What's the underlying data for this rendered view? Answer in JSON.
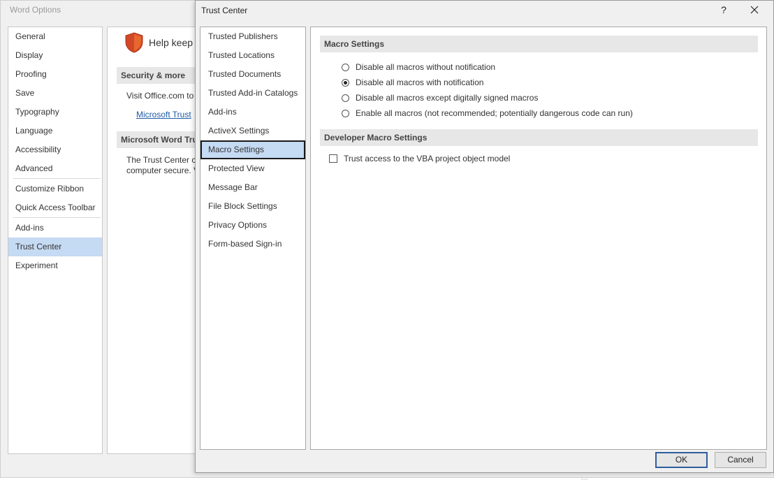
{
  "word_options": {
    "title": "Word Options",
    "nav": [
      "General",
      "Display",
      "Proofing",
      "Save",
      "Typography",
      "Language",
      "Accessibility",
      "Advanced",
      "Customize Ribbon",
      "Quick Access Toolbar",
      "Add-ins",
      "Trust Center",
      "Experiment"
    ],
    "selected_nav": "Trust Center",
    "content": {
      "help_keep": "Help keep y",
      "section1": "Security & more",
      "visit_text": "Visit Office.com to",
      "trust_link": "Microsoft Trust",
      "section2": "Microsoft Word Tru",
      "body_line1": "The Trust Center co",
      "body_line2": "computer secure. V"
    }
  },
  "trust_center": {
    "title": "Trust Center",
    "help_label": "?",
    "nav": [
      "Trusted Publishers",
      "Trusted Locations",
      "Trusted Documents",
      "Trusted Add-in Catalogs",
      "Add-ins",
      "ActiveX Settings",
      "Macro Settings",
      "Protected View",
      "Message Bar",
      "File Block Settings",
      "Privacy Options",
      "Form-based Sign-in"
    ],
    "selected_nav": "Macro Settings",
    "macro_section_title": "Macro Settings",
    "macro_options": [
      {
        "label": "Disable all macros without notification",
        "checked": false
      },
      {
        "label": "Disable all macros with notification",
        "checked": true
      },
      {
        "label": "Disable all macros except digitally signed macros",
        "checked": false
      },
      {
        "label": "Enable all macros (not recommended; potentially dangerous code can run)",
        "checked": false
      }
    ],
    "dev_section_title": "Developer Macro Settings",
    "vba_trust_label": "Trust access to the VBA project object model",
    "vba_trust_checked": false,
    "ok_label": "OK",
    "cancel_label": "Cancel"
  }
}
